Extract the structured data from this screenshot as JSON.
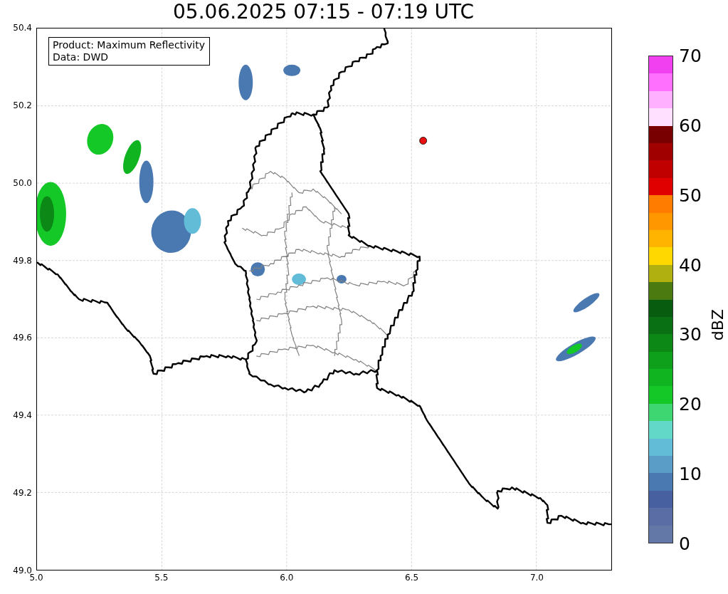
{
  "title": "05.06.2025 07:15 - 07:19 UTC",
  "annotation": {
    "lines": [
      "Product: Maximum Reflectivity",
      "Data: DWD"
    ]
  },
  "axes": {
    "xticks": [
      "5.0",
      "5.5",
      "6.0",
      "6.5",
      "7.0"
    ],
    "yticks": [
      "50.4",
      "50.2",
      "50.0",
      "49.8",
      "49.6",
      "49.4",
      "49.2",
      "49.0"
    ]
  },
  "colorbar": {
    "label": "dBZ",
    "ticks": [
      "70",
      "60",
      "50",
      "40",
      "30",
      "20",
      "10",
      "0"
    ],
    "segments": [
      {
        "color": "#6478a8"
      },
      {
        "color": "#5a6ea5"
      },
      {
        "color": "#4660a0"
      },
      {
        "color": "#4a78b0"
      },
      {
        "color": "#5a9ec8"
      },
      {
        "color": "#62bcd8"
      },
      {
        "color": "#62d8c8"
      },
      {
        "color": "#3dd670"
      },
      {
        "color": "#14c828"
      },
      {
        "color": "#10b420"
      },
      {
        "color": "#0ea01a"
      },
      {
        "color": "#0b8816"
      },
      {
        "color": "#0a7014"
      },
      {
        "color": "#085c10"
      },
      {
        "color": "#4a7a10"
      },
      {
        "color": "#b0b010"
      },
      {
        "color": "#ffd800"
      },
      {
        "color": "#ffb400"
      },
      {
        "color": "#ff9800"
      },
      {
        "color": "#ff7c00"
      },
      {
        "color": "#e00000"
      },
      {
        "color": "#c00000"
      },
      {
        "color": "#a00000"
      },
      {
        "color": "#780000"
      },
      {
        "color": "#ffe0ff"
      },
      {
        "color": "#ffb0ff"
      },
      {
        "color": "#ff70ff"
      },
      {
        "color": "#f040f0"
      }
    ]
  }
}
